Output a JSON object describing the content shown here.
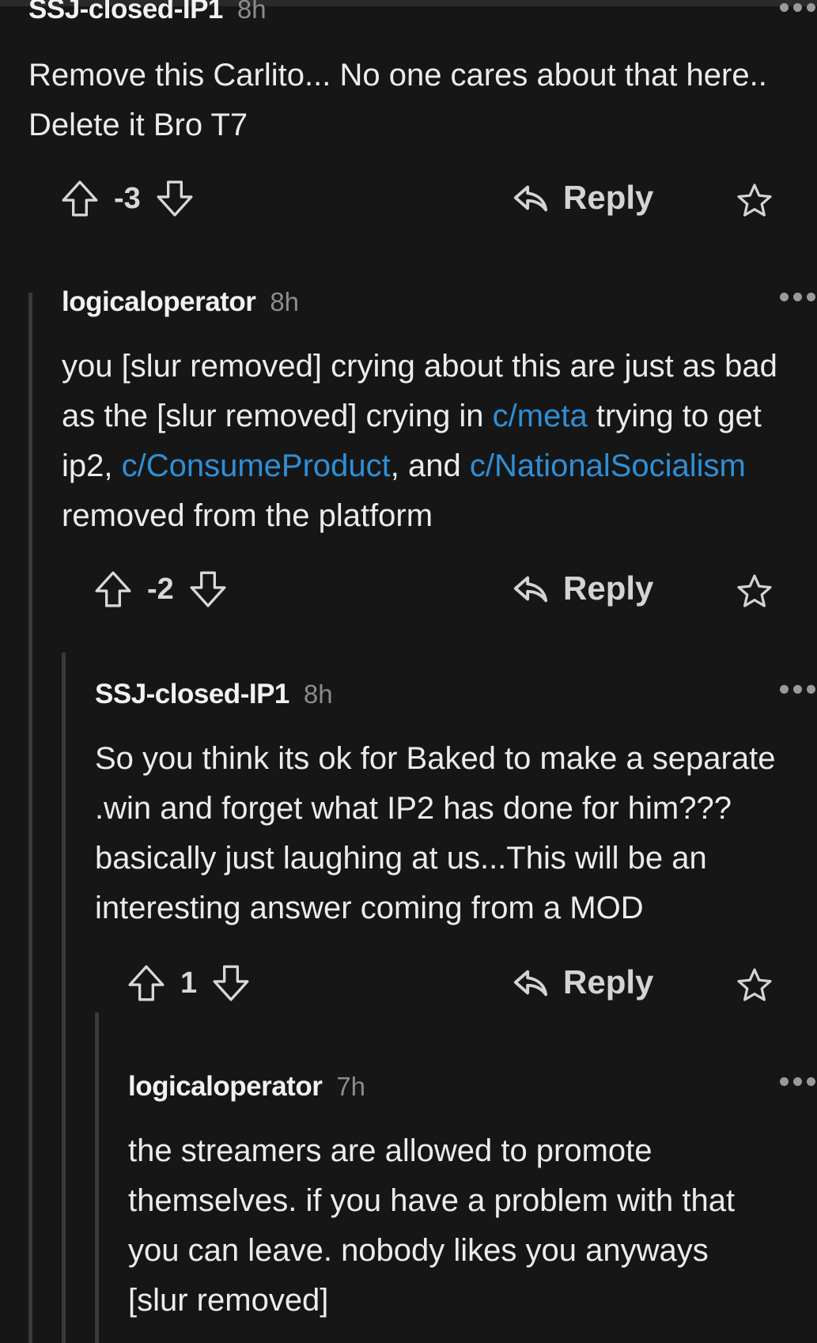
{
  "colors": {
    "background": "#161616",
    "text": "#ececec",
    "muted": "#8c8c8c",
    "link": "#2f8fd6",
    "thread_line": "#3a3a3c"
  },
  "reply_label": "Reply",
  "comments": [
    {
      "author": "SSJ-closed-IP1",
      "time": "8h",
      "body": [
        "Remove this Carlito... No one cares about that here.. Delete it Bro T7"
      ],
      "score": "-3"
    },
    {
      "author": "logicaloperator",
      "time": "8h",
      "body": [
        "you [slur removed] crying about this are just as bad as the [slur removed] crying in ",
        "c/meta",
        " trying to get ip2, ",
        "c/ConsumeProduct",
        ", and ",
        "c/NationalSocialism",
        " removed from the platform"
      ],
      "score": "-2"
    },
    {
      "author": "SSJ-closed-IP1",
      "time": "8h",
      "body": [
        "So you think its ok for Baked to make a separate .win and forget what IP2 has done for him??? basically just laughing at us...This will be an interesting answer coming from a MOD"
      ],
      "score": "1"
    },
    {
      "author": "logicaloperator",
      "time": "7h",
      "body": [
        "the streamers are allowed to promote themselves. if you have a problem with that you can leave. nobody likes you anyways [slur removed]"
      ]
    }
  ]
}
